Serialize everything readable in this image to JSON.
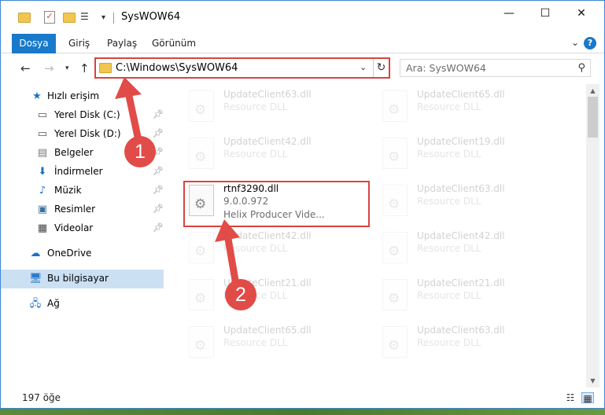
{
  "window": {
    "title": "SysWOW64",
    "controls": {
      "minimize": "—",
      "maximize": "☐",
      "close": "✕"
    }
  },
  "ribbon": {
    "tabs": [
      "Dosya",
      "Giriş",
      "Paylaş",
      "Görünüm"
    ],
    "help": "?"
  },
  "address_bar": {
    "path": "C:\\Windows\\SysWOW64"
  },
  "search": {
    "placeholder": "Ara: SysWOW64"
  },
  "nav_pane": {
    "items": [
      {
        "label": "Hızlı erişim",
        "icon": "star-icon",
        "pinned": false
      },
      {
        "label": "Yerel Disk (C:)",
        "icon": "drive-icon",
        "pinned": true
      },
      {
        "label": "Yerel Disk (D:)",
        "icon": "drive-icon",
        "pinned": true
      },
      {
        "label": "Belgeler",
        "icon": "documents-icon",
        "pinned": true
      },
      {
        "label": "İndirmeler",
        "icon": "download-icon",
        "pinned": true
      },
      {
        "label": "Müzik",
        "icon": "music-icon",
        "pinned": true
      },
      {
        "label": "Resimler",
        "icon": "pictures-icon",
        "pinned": true
      },
      {
        "label": "Videolar",
        "icon": "videos-icon",
        "pinned": true
      },
      {
        "label": "OneDrive",
        "icon": "cloud-icon",
        "pinned": false
      },
      {
        "label": "Bu bilgisayar",
        "icon": "computer-icon",
        "pinned": false,
        "selected": true
      },
      {
        "label": "Ağ",
        "icon": "network-icon",
        "pinned": false
      }
    ]
  },
  "files": {
    "left": [
      {
        "name": "UpdateClient63.dll",
        "line1": "Resource DLL",
        "line2": ""
      },
      {
        "name": "UpdateClient42.dll",
        "line1": "Resource DLL",
        "line2": ""
      },
      {
        "name": "rtnf3290.dll",
        "line1": "9.0.0.972",
        "line2": "Helix Producer Vide..."
      },
      {
        "name": "UpdateClient42.dll",
        "line1": "Resource DLL",
        "line2": ""
      },
      {
        "name": "UpdateClient21.dll",
        "line1": "Resource DLL",
        "line2": ""
      },
      {
        "name": "UpdateClient65.dll",
        "line1": "Resource DLL",
        "line2": ""
      }
    ],
    "right": [
      {
        "name": "UpdateClient65.dll",
        "line1": "Resource DLL"
      },
      {
        "name": "UpdateClient19.dll",
        "line1": "Resource DLL"
      },
      {
        "name": "UpdateClient63.dll",
        "line1": "Resource DLL"
      },
      {
        "name": "UpdateClient42.dll",
        "line1": "Resource DLL"
      },
      {
        "name": "UpdateClient21.dll",
        "line1": "Resource DLL"
      },
      {
        "name": "UpdateClient63.dll",
        "line1": "Resource DLL"
      }
    ]
  },
  "status_bar": {
    "item_count": "197 öğe"
  },
  "annotations": {
    "step1": "1",
    "step2": "2",
    "color": "#e14b48"
  }
}
